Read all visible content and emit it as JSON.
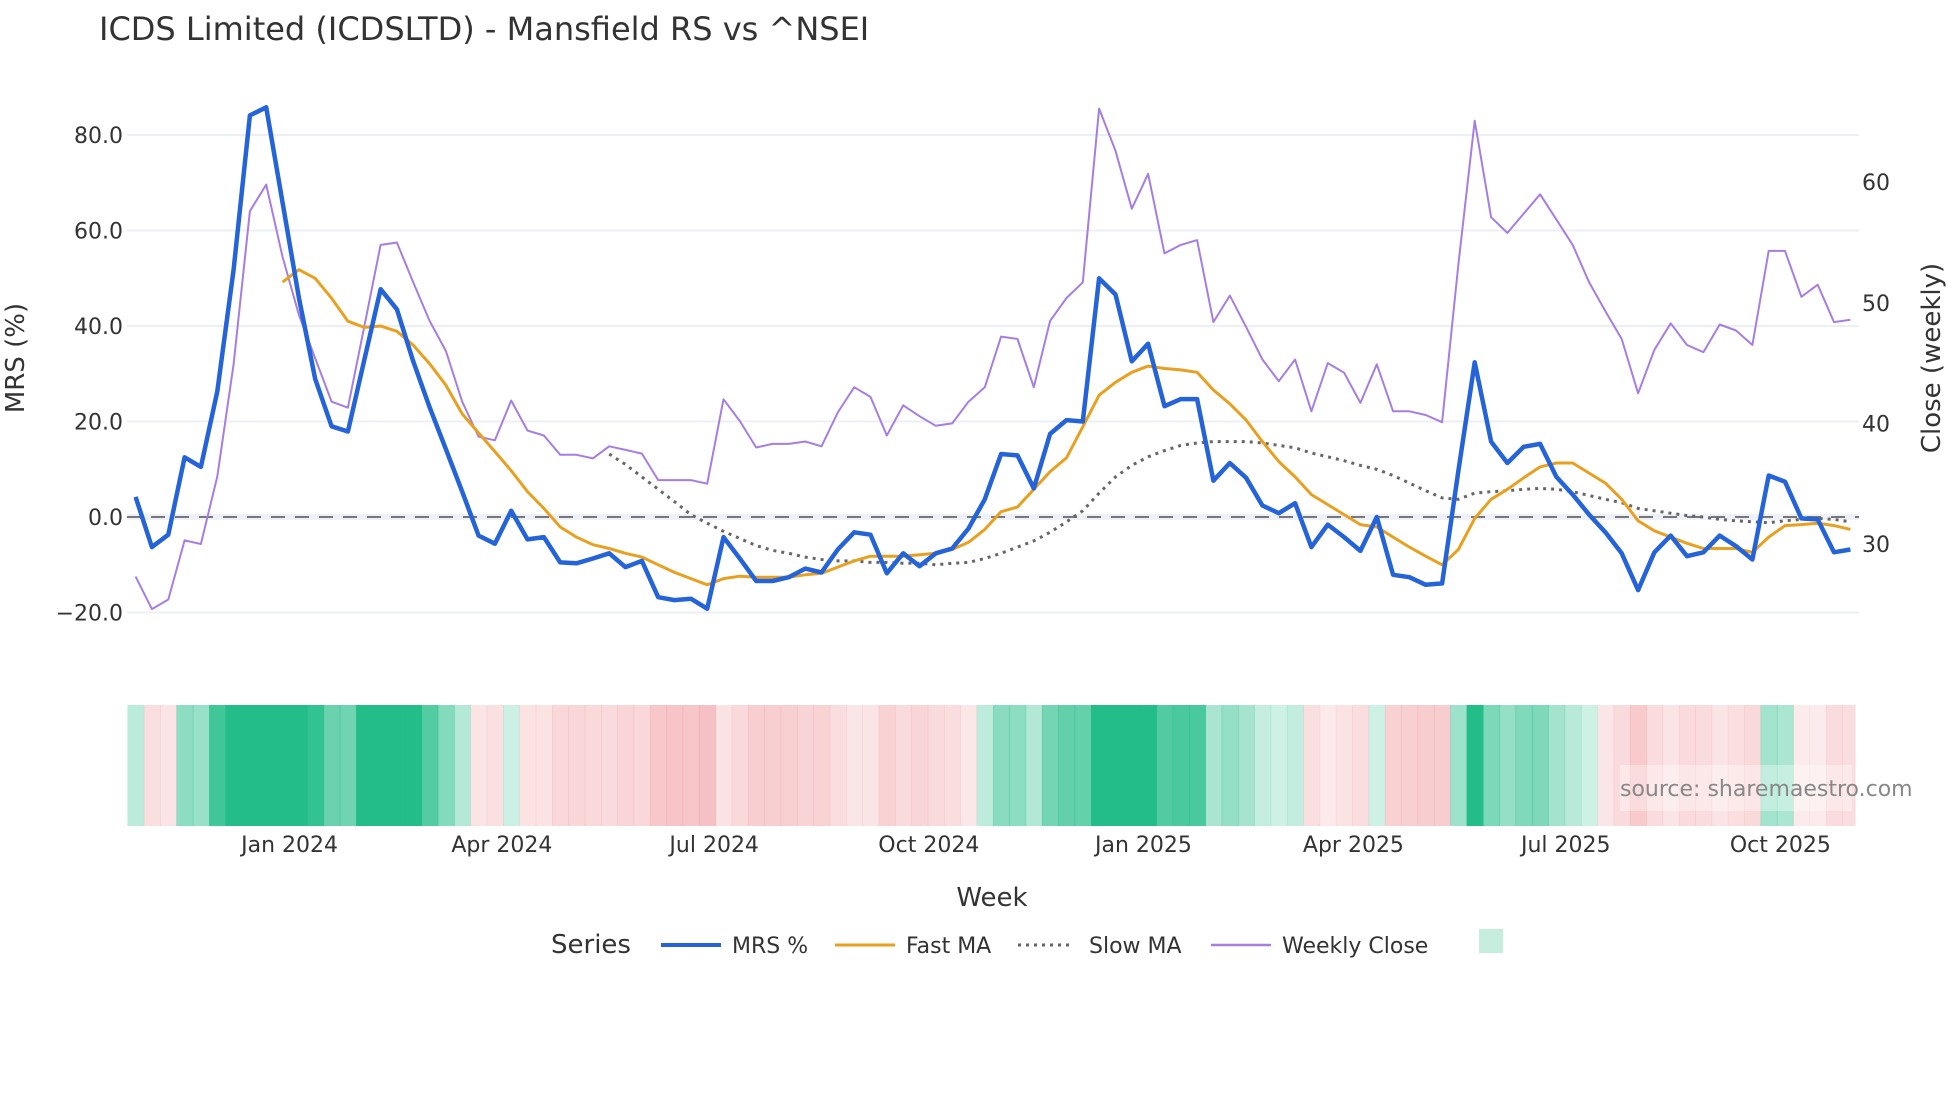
{
  "chart_data": {
    "type": "line",
    "title": "ICDS Limited (ICDSLTD) - Mansfield RS vs ^NSEI",
    "xlabel": "Week",
    "ylabel": "MRS (%)",
    "y2label": "Close (weekly)",
    "x_start": "2023-10-27",
    "x_step_days": 7,
    "ylim": [
      -25,
      90
    ],
    "y2lim": [
      22.9,
      66.5
    ],
    "yticks": [
      -20,
      0,
      20,
      40,
      60,
      80
    ],
    "ytick_labels": [
      "−20.0",
      "0.0",
      "20.0",
      "40.0",
      "60.0",
      "80.0"
    ],
    "y2ticks": [
      30,
      40,
      50,
      60
    ],
    "y2tick_labels": [
      "30",
      "40",
      "50",
      "60"
    ],
    "xticks": [
      {
        "date": "2024-01-01",
        "label": "Jan 2024"
      },
      {
        "date": "2024-04-01",
        "label": "Apr 2024"
      },
      {
        "date": "2024-07-01",
        "label": "Jul 2024"
      },
      {
        "date": "2024-10-01",
        "label": "Oct 2024"
      },
      {
        "date": "2025-01-01",
        "label": "Jan 2025"
      },
      {
        "date": "2025-04-01",
        "label": "Apr 2025"
      },
      {
        "date": "2025-07-01",
        "label": "Jul 2025"
      },
      {
        "date": "2025-10-01",
        "label": "Oct 2025"
      }
    ],
    "reference_line": 0,
    "grid": true,
    "legend_title": "Series",
    "legend_position": "bottom-center",
    "series": [
      {
        "name": "MRS %",
        "color": "#2563d9",
        "axis": "left",
        "values": [
          4.2,
          -6.3,
          -3.7,
          12.5,
          10.5,
          26.3,
          51.8,
          84.1,
          85.8,
          65.8,
          45.9,
          28.9,
          19,
          17.9,
          32.8,
          47.7,
          43.5,
          32.6,
          23,
          14.2,
          5.3,
          -3.9,
          -5.6,
          1.3,
          -4.7,
          -4.2,
          -9.5,
          -9.7,
          -8.7,
          -7.6,
          -10.5,
          -9.2,
          -16.8,
          -17.4,
          -17.1,
          -19.2,
          -4.2,
          -8.7,
          -13.4,
          -13.4,
          -12.6,
          -10.8,
          -11.6,
          -6.8,
          -3.2,
          -3.7,
          -11.8,
          -7.6,
          -10.3,
          -7.6,
          -6.6,
          -2.4,
          3.7,
          13.2,
          12.9,
          6,
          17.4,
          20.3,
          20,
          50,
          46.6,
          32.6,
          36.3,
          23.2,
          24.7,
          24.7,
          7.6,
          11.3,
          8.2,
          2.4,
          0.8,
          2.9,
          -6.3,
          -1.6,
          -4.2,
          -7.1,
          0,
          -12.1,
          -12.6,
          -14.2,
          -13.9,
          9.7,
          32.4,
          15.8,
          11.3,
          14.7,
          15.3,
          8.4,
          4.7,
          0.5,
          -3.2,
          -7.6,
          -15.3,
          -7.4,
          -3.9,
          -8.2,
          -7.4,
          -3.9,
          -6.1,
          -8.9,
          8.7,
          7.4,
          -0.3,
          -0.5,
          -7.4,
          -6.8
        ]
      },
      {
        "name": "Fast MA",
        "color": "#e8a020",
        "axis": "left",
        "values": [
          null,
          null,
          null,
          null,
          null,
          null,
          null,
          null,
          null,
          49.2,
          51.8,
          50,
          45.8,
          41,
          39.7,
          40,
          38.9,
          36,
          32.1,
          27.6,
          21.6,
          17.6,
          13.7,
          9.7,
          5.3,
          1.8,
          -2.1,
          -4.2,
          -5.8,
          -6.6,
          -7.6,
          -8.4,
          -10,
          -11.6,
          -12.9,
          -14.2,
          -12.9,
          -12.4,
          -12.6,
          -12.6,
          -12.6,
          -12.1,
          -11.8,
          -10.5,
          -9.2,
          -8.2,
          -8.2,
          -8.2,
          -7.9,
          -7.6,
          -6.8,
          -5.3,
          -2.6,
          1.1,
          2.1,
          5.8,
          9.5,
          12.4,
          18.9,
          25.5,
          28.2,
          30.3,
          31.6,
          31.1,
          30.8,
          30.3,
          26.6,
          23.7,
          20.3,
          15.8,
          11.6,
          8.4,
          4.7,
          2.6,
          0.5,
          -1.6,
          -2.1,
          -4.2,
          -6.3,
          -8.2,
          -10,
          -6.8,
          -0.3,
          3.7,
          5.8,
          8.2,
          10.5,
          11.3,
          11.3,
          9.2,
          7.1,
          3.7,
          -0.8,
          -2.9,
          -4.2,
          -5.5,
          -6.6,
          -6.6,
          -6.6,
          -7.4,
          -4.2,
          -1.8,
          -1.6,
          -1.3,
          -1.8,
          -2.6
        ]
      },
      {
        "name": "Slow MA",
        "color": "#666666",
        "axis": "left",
        "dash": "dot",
        "values": [
          null,
          null,
          null,
          null,
          null,
          null,
          null,
          null,
          null,
          null,
          null,
          null,
          null,
          null,
          null,
          null,
          null,
          null,
          null,
          null,
          null,
          null,
          null,
          null,
          null,
          null,
          null,
          null,
          null,
          13.2,
          11,
          8.4,
          5.8,
          3.2,
          0.5,
          -1.3,
          -3,
          -4.5,
          -6,
          -7,
          -7.6,
          -8.4,
          -8.9,
          -9.2,
          -9.2,
          -9.5,
          -9.5,
          -9.7,
          -9.7,
          -10,
          -9.7,
          -9.5,
          -8.7,
          -7.6,
          -6.3,
          -5,
          -3.2,
          -1,
          1.3,
          5,
          8.4,
          10.8,
          12.6,
          13.9,
          15,
          15.5,
          15.8,
          15.8,
          15.8,
          15.5,
          15,
          14.5,
          13.4,
          12.6,
          11.8,
          10.8,
          10,
          8.7,
          7.1,
          5.5,
          4,
          3.7,
          5,
          5.3,
          5.5,
          5.8,
          6,
          5.8,
          5.3,
          4.5,
          3.7,
          3,
          1.8,
          1.3,
          0.8,
          0.3,
          0,
          -0.5,
          -0.8,
          -1,
          -1.2,
          -0.8,
          -0.5,
          -0.3,
          -0.5,
          -1
        ]
      },
      {
        "name": "Weekly Close",
        "color": "#a57ee0",
        "axis": "right",
        "values": [
          27.3,
          24.6,
          25.4,
          30.3,
          30,
          35.6,
          44.9,
          57.6,
          59.8,
          53.8,
          49,
          45.4,
          41.8,
          41.3,
          48,
          54.8,
          55,
          51.7,
          48.5,
          46,
          41.8,
          38.9,
          38.6,
          41.9,
          39.4,
          39,
          37.4,
          37.4,
          37.1,
          38.1,
          37.8,
          37.5,
          35.3,
          35.3,
          35.3,
          35,
          42,
          40.2,
          38,
          38.3,
          38.3,
          38.5,
          38.1,
          40.9,
          43,
          42.2,
          39,
          41.5,
          40.6,
          39.8,
          40,
          41.8,
          43,
          47.2,
          47,
          43,
          48.5,
          50.4,
          51.7,
          66.1,
          62.6,
          57.8,
          60.7,
          54.1,
          54.8,
          55.2,
          48.4,
          50.6,
          48,
          45.3,
          43.5,
          45.3,
          41,
          45,
          44.2,
          41.7,
          44.9,
          41,
          41,
          40.7,
          40.1,
          53.2,
          65.1,
          57.1,
          55.8,
          57.4,
          59,
          56.9,
          54.8,
          51.7,
          49.3,
          47,
          42.5,
          46.1,
          48.3,
          46.5,
          45.9,
          48.2,
          47.7,
          46.5,
          54.3,
          54.3,
          50.5,
          51.5,
          48.4,
          48.6
        ]
      }
    ],
    "heatmap": {
      "based_on": "MRS %",
      "positive_color": "#22bd88",
      "negative_color": "#f19a9e"
    },
    "legend_swatch_color": "#c5eede"
  },
  "source": "source: sharemaestro.com"
}
